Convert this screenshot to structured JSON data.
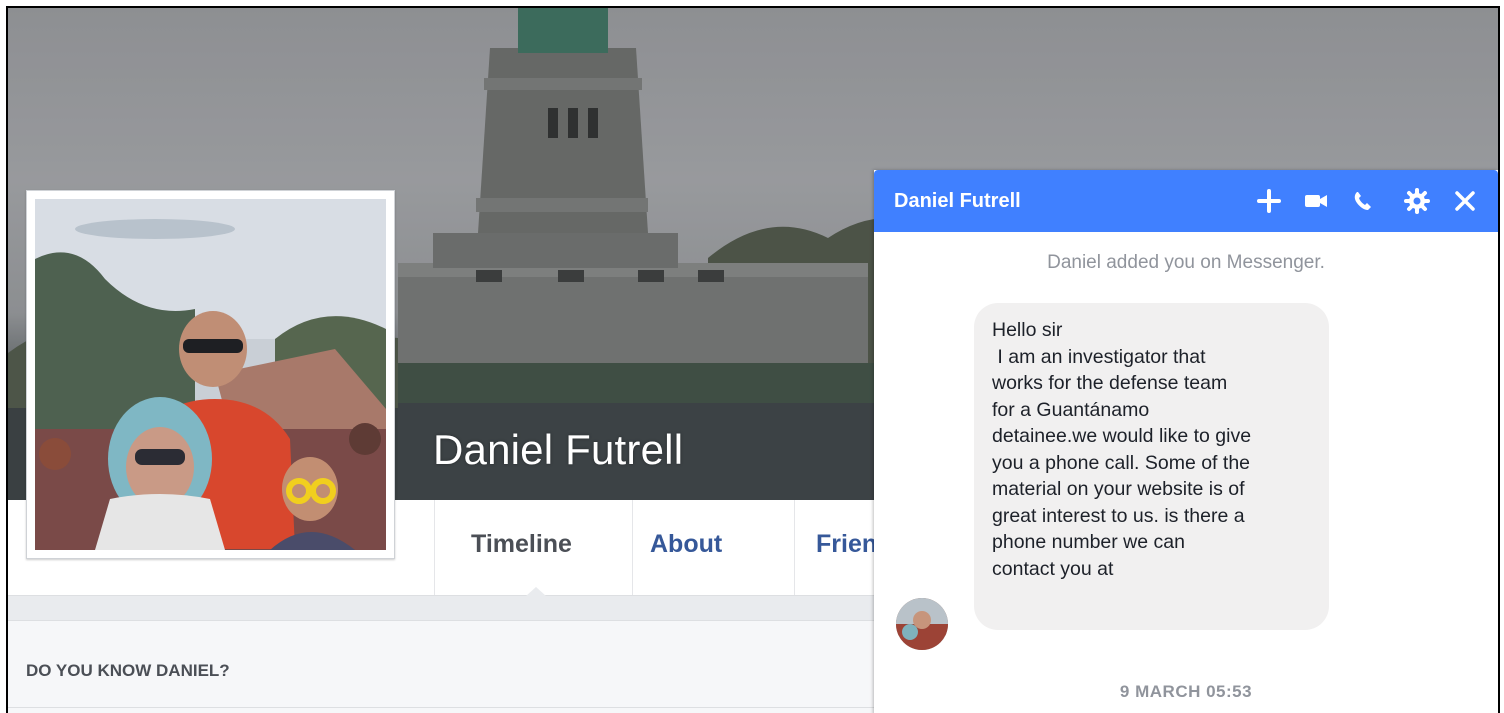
{
  "profile": {
    "name": "Daniel Futrell"
  },
  "nav": {
    "tabs": [
      {
        "label": "Timeline",
        "active": true
      },
      {
        "label": "About",
        "active": false
      },
      {
        "label": "Friends",
        "active": false
      }
    ]
  },
  "suggest": {
    "title": "DO YOU KNOW DANIEL?"
  },
  "chat": {
    "title": "Daniel Futrell",
    "header_color": "#4080ff",
    "header_icons": [
      "add-icon",
      "video-call-icon",
      "phone-icon",
      "gear-icon",
      "close-icon"
    ],
    "system_message": "Daniel added you on Messenger.",
    "message_lines": [
      "Hello sir",
      " I am an investigator that",
      "works for the defense team",
      "for a Guantánamo",
      "detainee.we would like to give",
      "you a phone call. Some of the",
      "material on your website is of",
      "great interest to us. is there a",
      "phone number we can",
      "contact you at"
    ],
    "timestamp": "9 MARCH 05:53"
  }
}
